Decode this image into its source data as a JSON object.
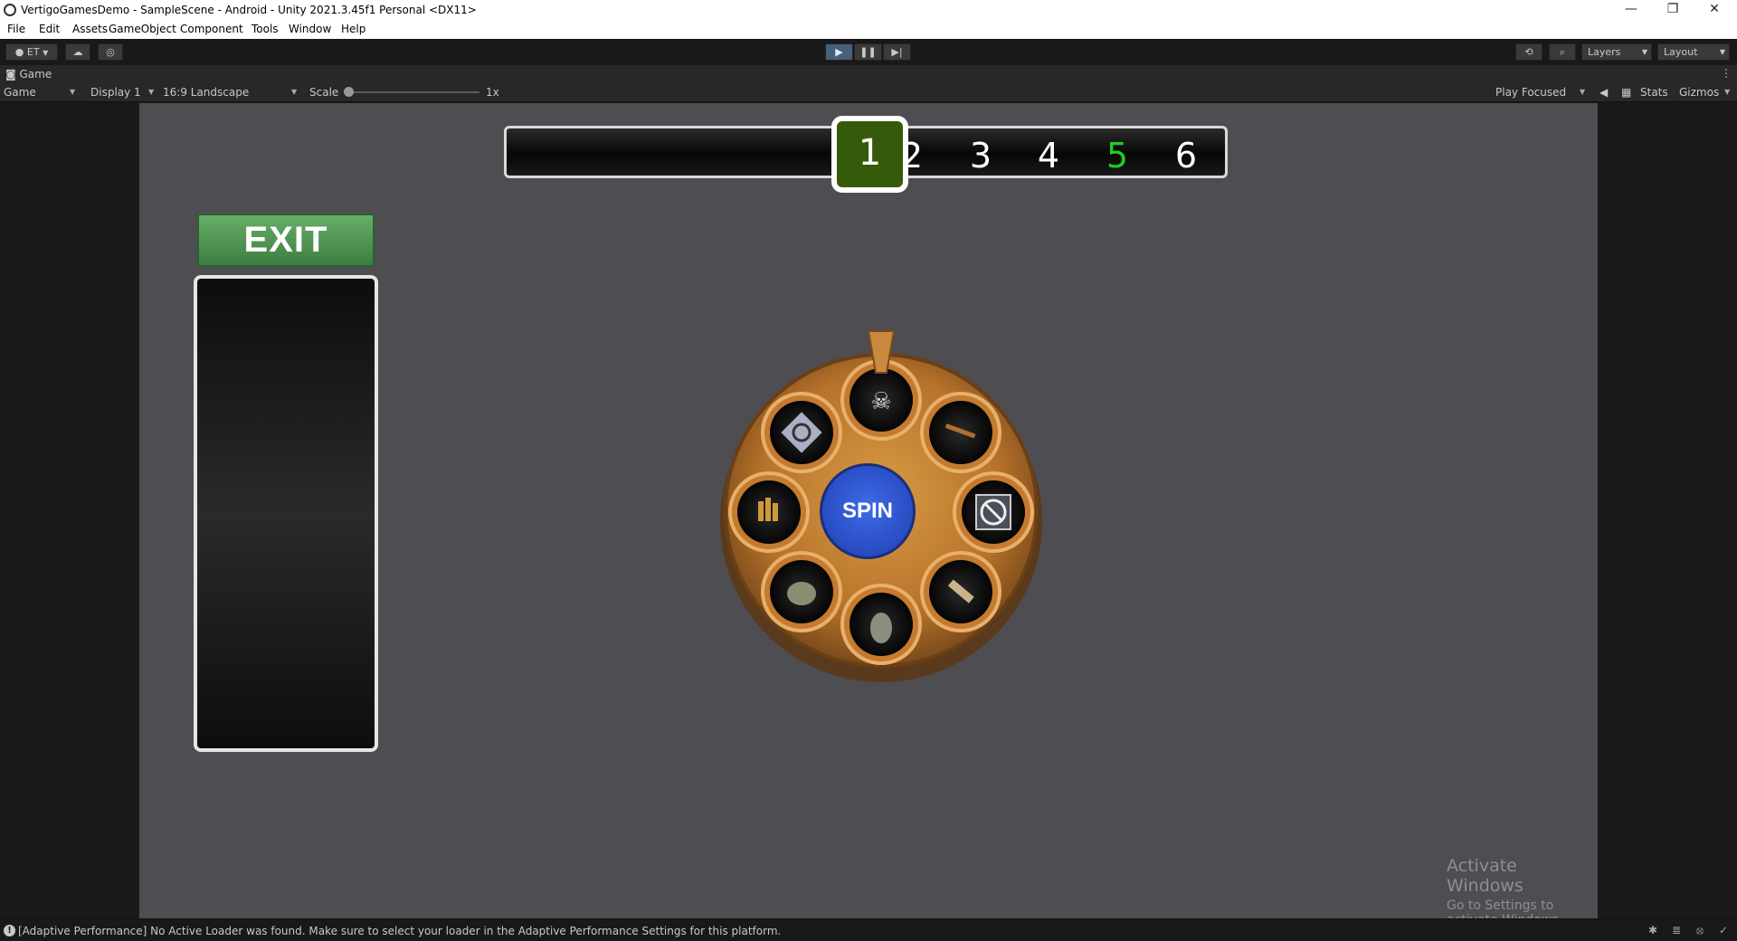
{
  "window": {
    "title": "VertigoGamesDemo - SampleScene - Android - Unity 2021.3.45f1 Personal <DX11>",
    "minimize": "—",
    "restore": "❐",
    "close": "✕"
  },
  "menu": [
    "File",
    "Edit",
    "Assets",
    "GameObject",
    "Component",
    "Tools",
    "Window",
    "Help"
  ],
  "toolbar": {
    "account": "ET",
    "layers": "Layers",
    "layout": "Layout"
  },
  "tab": {
    "label": "Game"
  },
  "gamebar": {
    "mode": "Game",
    "display": "Display 1",
    "aspect": "16:9 Landscape",
    "scale_label": "Scale",
    "scale_value": "1x",
    "play_focused": "Play Focused",
    "stats": "Stats",
    "gizmos": "Gizmos"
  },
  "game": {
    "levels": [
      "1",
      "2",
      "3",
      "4",
      "5",
      "6"
    ],
    "current_level": "1",
    "exit_label": "EXIT",
    "spin_label": "SPIN",
    "highlight_level_color": "#22cc22",
    "wheel_slots": [
      "skull-icon",
      "rifle-icon",
      "no-entry-icon",
      "knife-icon",
      "armor-icon",
      "grenade-icon",
      "ammo-icon",
      "shield-timer-icon"
    ]
  },
  "watermark": {
    "line1": "Activate Windows",
    "line2": "Go to Settings to activate Windows."
  },
  "status": {
    "message": "[Adaptive Performance] No Active Loader was found. Make sure to select your loader in the Adaptive Performance Settings for this platform."
  }
}
